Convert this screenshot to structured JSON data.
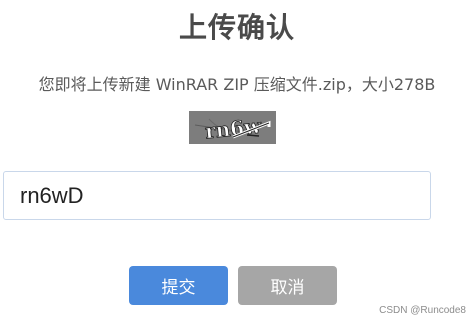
{
  "dialog": {
    "title": "上传确认",
    "message": "您即将上传新建 WinRAR ZIP 压缩文件.zip，大小278B"
  },
  "captcha": {
    "text": "rn6w"
  },
  "code_input": {
    "value": "rn6wD",
    "placeholder": ""
  },
  "buttons": {
    "submit_label": "提交",
    "cancel_label": "取消"
  },
  "watermark": {
    "text": "CSDN @Runcode8"
  },
  "colors": {
    "submit": "#4a89dc",
    "cancel": "#a6a6a6",
    "captcha_bg": "#7d7d7d"
  }
}
